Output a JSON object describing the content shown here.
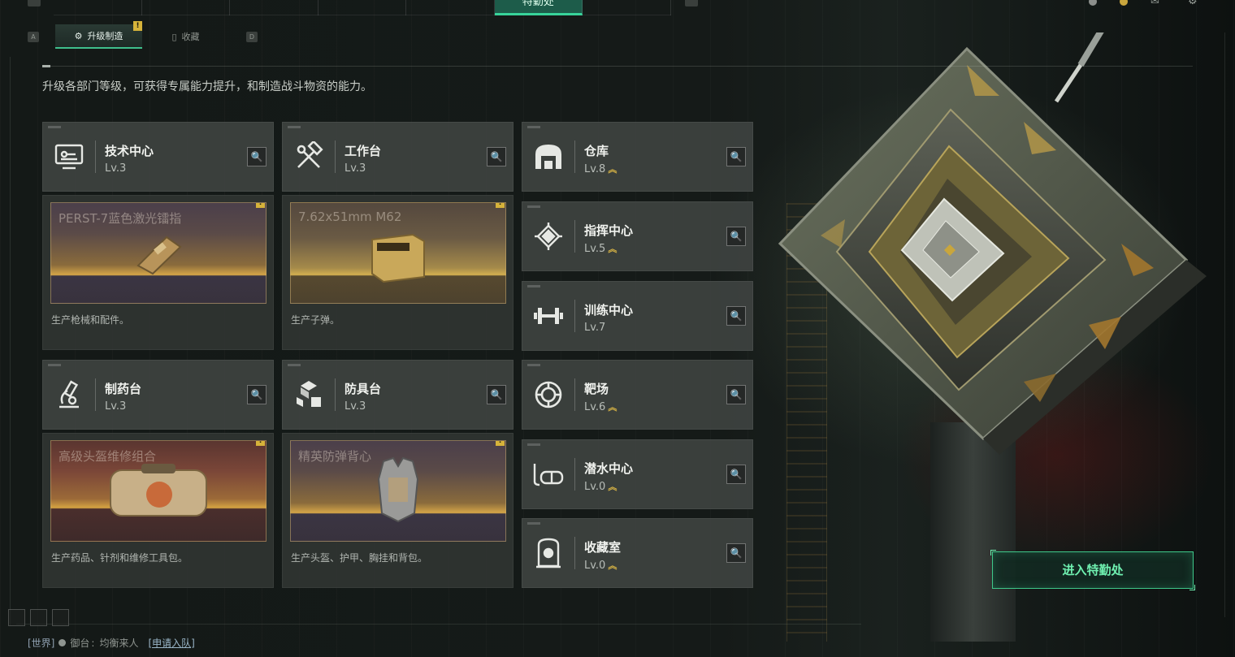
{
  "top_nav": {
    "tabs": [
      {
        "label": ""
      },
      {
        "label": ""
      },
      {
        "label": ""
      },
      {
        "label": ""
      },
      {
        "label": ""
      },
      {
        "label": "特勤处",
        "active": true
      },
      {
        "label": ""
      }
    ],
    "currency_silver": "",
    "currency_gold": ""
  },
  "sub_tabs": [
    {
      "label": "升级制造",
      "active": true,
      "badge": "!",
      "icon": "craft-icon"
    },
    {
      "label": "收藏",
      "active": false,
      "icon": "collection-icon"
    }
  ],
  "keys": {
    "left": "A",
    "right": "D"
  },
  "intro": "升级各部门等级，可获得专属能力提升，和制造战斗物资的能力。",
  "departments": [
    {
      "name": "技术中心",
      "level": "Lv.3",
      "icon": "tech-center-icon",
      "upgradable": false
    },
    {
      "name": "工作台",
      "level": "Lv.3",
      "icon": "workbench-icon",
      "upgradable": false
    },
    {
      "name": "制药台",
      "level": "Lv.3",
      "icon": "pharmacy-icon",
      "upgradable": false
    },
    {
      "name": "防具台",
      "level": "Lv.3",
      "icon": "armor-bench-icon",
      "upgradable": false
    },
    {
      "name": "仓库",
      "level": "Lv.8",
      "icon": "warehouse-icon",
      "upgradable": true
    },
    {
      "name": "指挥中心",
      "level": "Lv.5",
      "icon": "command-center-icon",
      "upgradable": true
    },
    {
      "name": "训练中心",
      "level": "Lv.7",
      "icon": "training-center-icon",
      "upgradable": false
    },
    {
      "name": "靶场",
      "level": "Lv.6",
      "icon": "range-icon",
      "upgradable": true
    },
    {
      "name": "潜水中心",
      "level": "Lv.0",
      "icon": "diving-center-icon",
      "upgradable": true
    },
    {
      "name": "收藏室",
      "level": "Lv.0",
      "icon": "collection-room-icon",
      "upgradable": true
    }
  ],
  "products": [
    {
      "title": "PERST-7蓝色激光镭指",
      "desc": "生产枪械和配件。",
      "badge": "!"
    },
    {
      "title": "7.62x51mm M62",
      "desc": "生产子弹。",
      "badge": "!"
    },
    {
      "title": "高级头盔维修组合",
      "desc": "生产药品、针剂和维修工具包。",
      "badge": "!"
    },
    {
      "title": "精英防弹背心",
      "desc": "生产头盔、护甲、胸挂和背包。",
      "badge": "!"
    }
  ],
  "upgrade_chevron": "︽",
  "enter_button": "进入特勤处",
  "chat": {
    "channel": "[世界]",
    "user": "御台",
    "message": "均衡来人",
    "action": "[申请入队]"
  },
  "colors": {
    "accent": "#3ec88a",
    "gold": "#d8b445",
    "card": "#3e4240",
    "warn": "#d6b33a"
  }
}
